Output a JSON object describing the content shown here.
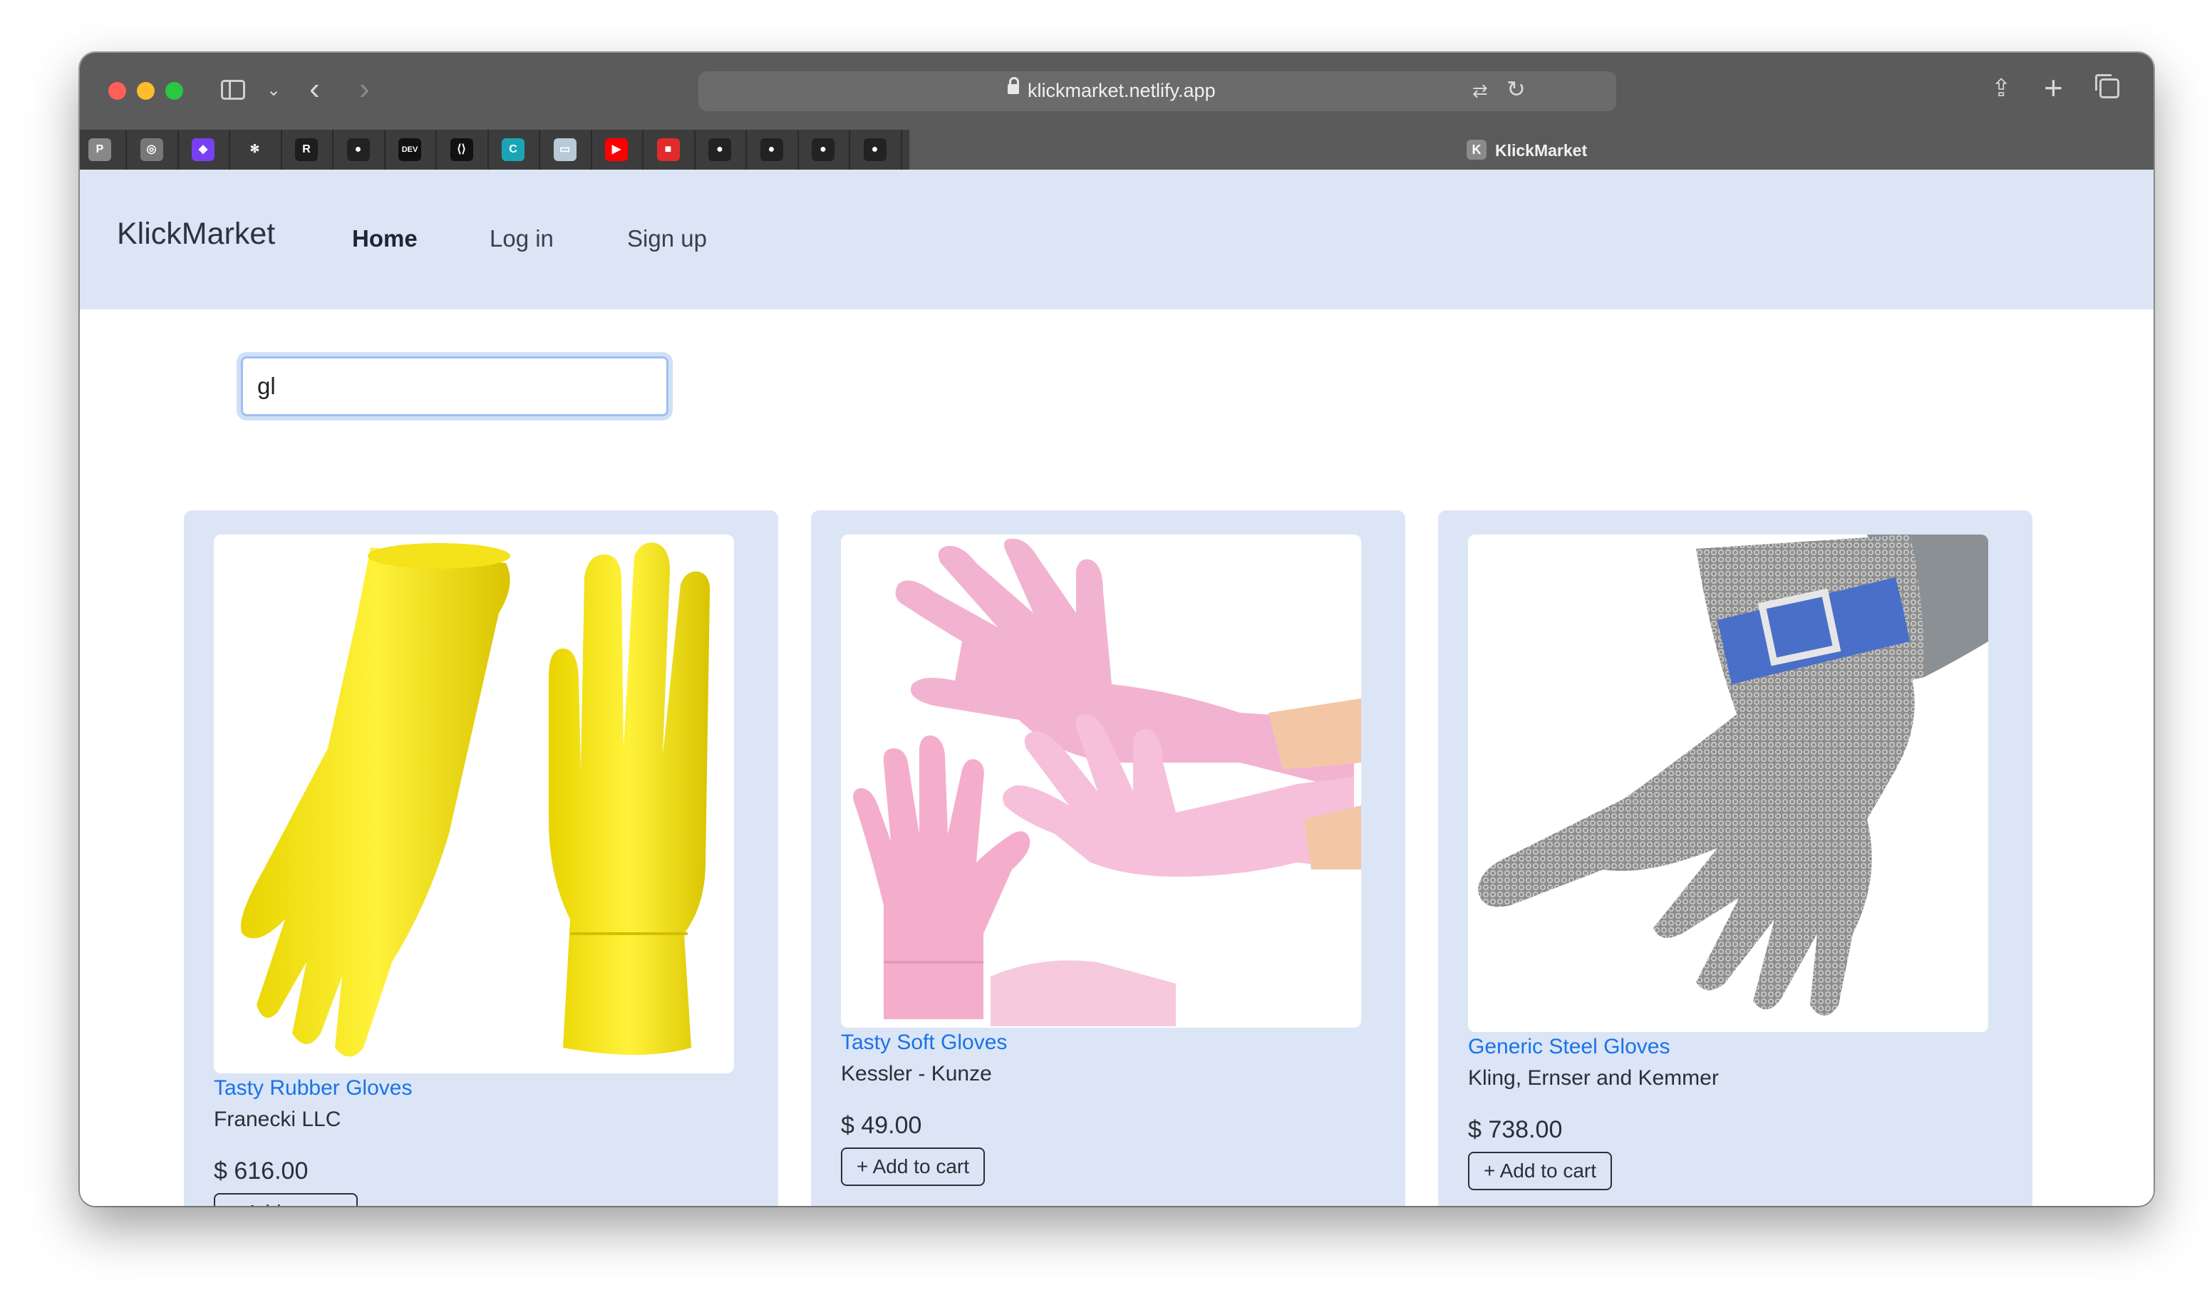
{
  "browser": {
    "url": "klickmarket.netlify.app",
    "active_tab_title": "KlickMarket",
    "active_tab_favicon": "K",
    "pinned_tabs": [
      {
        "icon": "p-app-icon",
        "glyph": "P",
        "bg": "#888888"
      },
      {
        "icon": "circle-logo-icon",
        "glyph": "◎",
        "bg": "#777777"
      },
      {
        "icon": "purple-gem-icon",
        "glyph": "◆",
        "bg": "#7b3ff2"
      },
      {
        "icon": "asterisk-icon",
        "glyph": "✻",
        "bg": "#3c3c3c"
      },
      {
        "icon": "rm-icon",
        "glyph": "R",
        "bg": "#1d1d1d"
      },
      {
        "icon": "github-icon",
        "glyph": "●",
        "bg": "#222222"
      },
      {
        "icon": "dev-icon",
        "glyph": "DEV",
        "bg": "#111111"
      },
      {
        "icon": "code-icon",
        "glyph": "⟨⟩",
        "bg": "#111111"
      },
      {
        "icon": "c-logo-icon",
        "glyph": "C",
        "bg": "#1aa5b5"
      },
      {
        "icon": "chat-icon",
        "glyph": "▭",
        "bg": "#b9c9d8"
      },
      {
        "icon": "youtube-icon",
        "glyph": "▶",
        "bg": "#ff0000"
      },
      {
        "icon": "red-pin-icon",
        "glyph": "■",
        "bg": "#e12b2b"
      },
      {
        "icon": "github-icon",
        "glyph": "●",
        "bg": "#222222"
      },
      {
        "icon": "github-icon",
        "glyph": "●",
        "bg": "#222222"
      },
      {
        "icon": "github-icon",
        "glyph": "●",
        "bg": "#222222"
      },
      {
        "icon": "github-icon",
        "glyph": "●",
        "bg": "#222222"
      }
    ]
  },
  "nav": {
    "brand": "KlickMarket",
    "links": [
      "Home",
      "Log in",
      "Sign up"
    ]
  },
  "search": {
    "value": "gl"
  },
  "products": [
    {
      "name": "Tasty Rubber Gloves",
      "vendor": "Franecki LLC",
      "price": "$ 616.00",
      "button": "+ Add to cart",
      "image": "yellow-rubber-gloves"
    },
    {
      "name": "Tasty Soft Gloves",
      "vendor": "Kessler - Kunze",
      "price": "$ 49.00",
      "button": "+ Add to cart",
      "image": "pink-soft-gloves"
    },
    {
      "name": "Generic Steel Gloves",
      "vendor": "Kling, Ernser and Kemmer",
      "price": "$ 738.00",
      "button": "+ Add to cart",
      "image": "steel-mesh-glove"
    }
  ],
  "colors": {
    "navbar_bg": "#dbe5f6",
    "card_bg": "#dbe5f6",
    "link": "#1a73e8"
  }
}
